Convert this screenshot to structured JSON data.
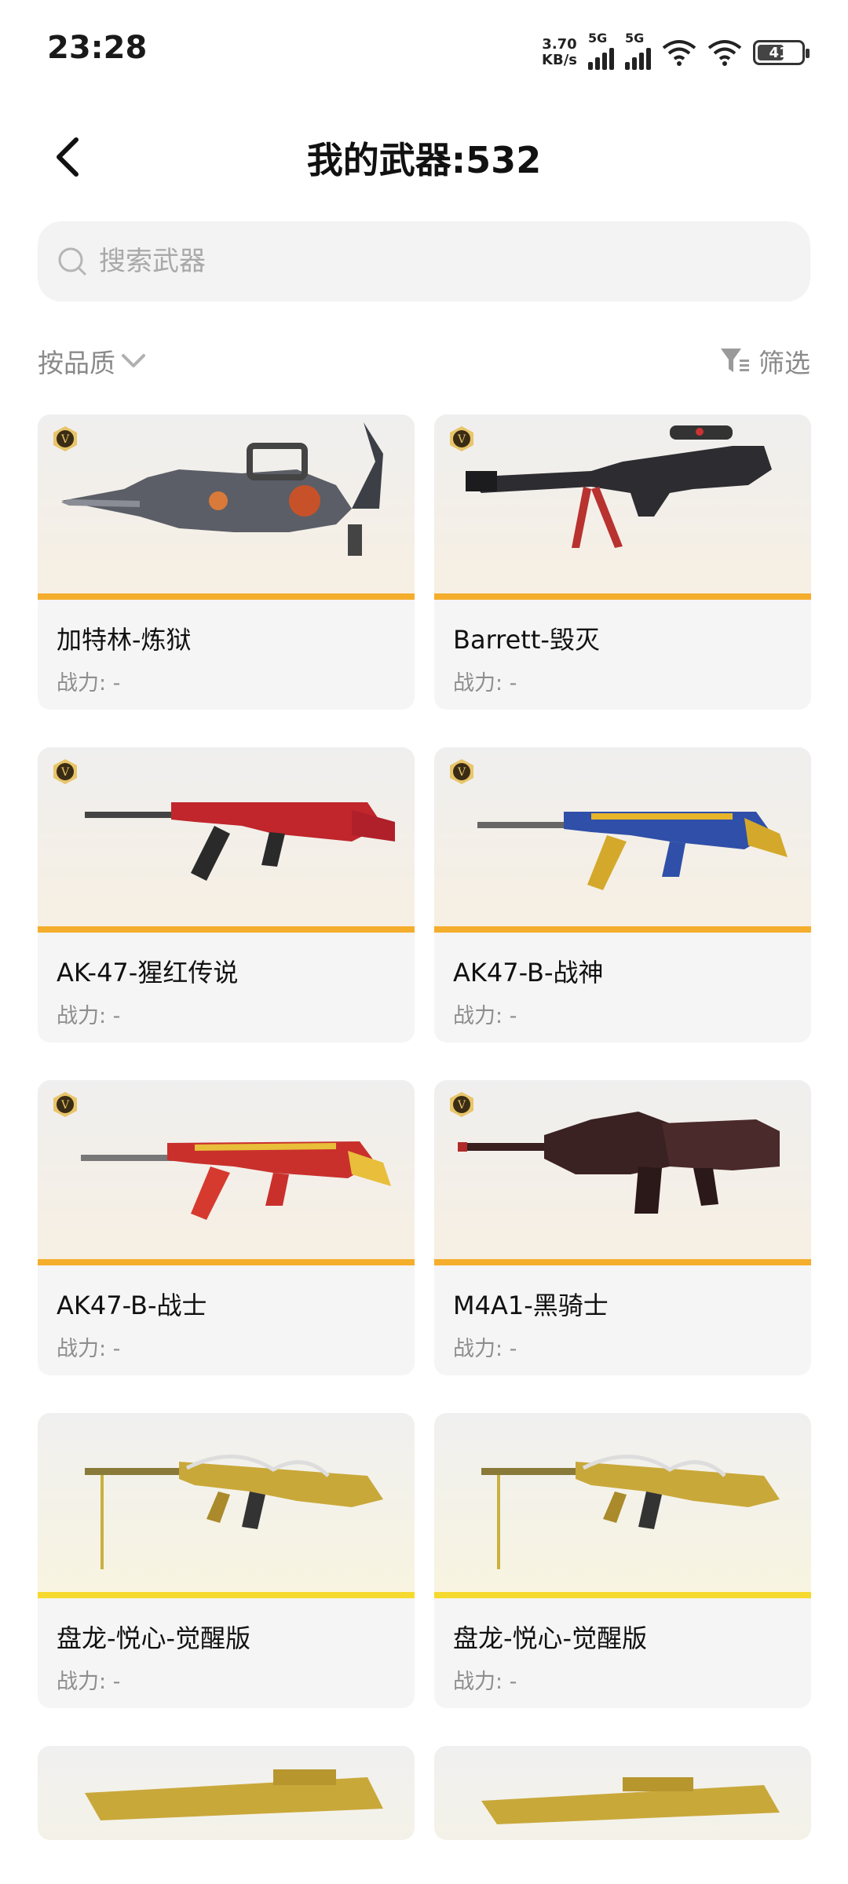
{
  "status_bar": {
    "time": "23:28",
    "net_speed_value": "3.70",
    "net_speed_unit": "KB/s",
    "sim1": "5G",
    "sim2": "5G",
    "battery": "41"
  },
  "header": {
    "title": "我的武器:532"
  },
  "search": {
    "placeholder": "搜索武器"
  },
  "filters": {
    "sort_label": "按品质",
    "filter_label": "筛选"
  },
  "weapons": [
    {
      "name": "加特林-炼狱",
      "power": "战力: -",
      "badge": true,
      "stripe": "orange"
    },
    {
      "name": "Barrett-毁灭",
      "power": "战力: -",
      "badge": true,
      "stripe": "orange"
    },
    {
      "name": "AK-47-猩红传说",
      "power": "战力: -",
      "badge": true,
      "stripe": "orange"
    },
    {
      "name": "AK47-B-战神",
      "power": "战力: -",
      "badge": true,
      "stripe": "orange"
    },
    {
      "name": "AK47-B-战士",
      "power": "战力: -",
      "badge": true,
      "stripe": "orange"
    },
    {
      "name": "M4A1-黑骑士",
      "power": "战力: -",
      "badge": true,
      "stripe": "orange"
    },
    {
      "name": "盘龙-悦心-觉醒版",
      "power": "战力: -",
      "badge": false,
      "stripe": "yellow"
    },
    {
      "name": "盘龙-悦心-觉醒版",
      "power": "战力: -",
      "badge": false,
      "stripe": "yellow"
    }
  ],
  "colors": {
    "accent_orange": "#f5ad2c",
    "accent_yellow": "#f6d92e",
    "card_bg": "#f5f5f5",
    "muted_text": "#8a8a8a"
  }
}
